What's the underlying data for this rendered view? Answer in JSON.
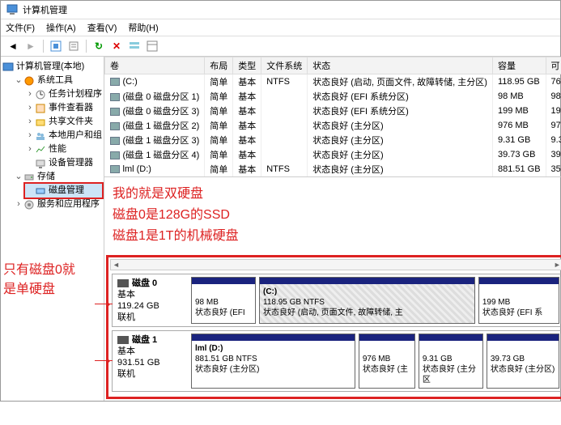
{
  "title": "计算机管理",
  "menu": {
    "file": "文件(F)",
    "action": "操作(A)",
    "view": "查看(V)",
    "help": "帮助(H)"
  },
  "tree": {
    "root": "计算机管理(本地)",
    "sys": "系统工具",
    "sys_items": [
      "任务计划程序",
      "事件查看器",
      "共享文件夹",
      "本地用户和组",
      "性能",
      "设备管理器"
    ],
    "storage": "存储",
    "disk_mgmt": "磁盘管理",
    "services": "服务和应用程序"
  },
  "cols": {
    "vol": "卷",
    "layout": "布局",
    "type": "类型",
    "fs": "文件系统",
    "status": "状态",
    "cap": "容量",
    "free": "可"
  },
  "vols": [
    {
      "n": "(C:)",
      "l": "简单",
      "t": "基本",
      "fs": "NTFS",
      "s": "状态良好 (启动, 页面文件, 故障转储, 主分区)",
      "c": "118.95 GB",
      "f": "76"
    },
    {
      "n": "(磁盘 0 磁盘分区 1)",
      "l": "简单",
      "t": "基本",
      "fs": "",
      "s": "状态良好 (EFI 系统分区)",
      "c": "98 MB",
      "f": "98"
    },
    {
      "n": "(磁盘 0 磁盘分区 3)",
      "l": "简单",
      "t": "基本",
      "fs": "",
      "s": "状态良好 (EFI 系统分区)",
      "c": "199 MB",
      "f": "19"
    },
    {
      "n": "(磁盘 1 磁盘分区 2)",
      "l": "简单",
      "t": "基本",
      "fs": "",
      "s": "状态良好 (主分区)",
      "c": "976 MB",
      "f": "97"
    },
    {
      "n": "(磁盘 1 磁盘分区 3)",
      "l": "简单",
      "t": "基本",
      "fs": "",
      "s": "状态良好 (主分区)",
      "c": "9.31 GB",
      "f": "9.3"
    },
    {
      "n": "(磁盘 1 磁盘分区 4)",
      "l": "简单",
      "t": "基本",
      "fs": "",
      "s": "状态良好 (主分区)",
      "c": "39.73 GB",
      "f": "39"
    },
    {
      "n": "lml (D:)",
      "l": "简单",
      "t": "基本",
      "fs": "NTFS",
      "s": "状态良好 (主分区)",
      "c": "881.51 GB",
      "f": "35"
    }
  ],
  "anno": {
    "l1": "我的就是双硬盘",
    "l2": "磁盘0是128G的SSD",
    "l3": "磁盘1是1T的机械硬盘",
    "left1": "只有磁盘0就",
    "left2": "是单硬盘"
  },
  "disk0": {
    "name": "磁盘 0",
    "type": "基本",
    "size": "119.24 GB",
    "state": "联机",
    "p1": {
      "l1": "98 MB",
      "l2": "状态良好 (EFI"
    },
    "p2": {
      "l0": "(C:)",
      "l1": "118.95 GB NTFS",
      "l2": "状态良好 (启动, 页面文件, 故障转储, 主"
    },
    "p3": {
      "l1": "199 MB",
      "l2": "状态良好 (EFI 系"
    }
  },
  "disk1": {
    "name": "磁盘 1",
    "type": "基本",
    "size": "931.51 GB",
    "state": "联机",
    "p1": {
      "l0": "lml (D:)",
      "l1": "881.51 GB NTFS",
      "l2": "状态良好 (主分区)"
    },
    "p2": {
      "l1": "976 MB",
      "l2": "状态良好 (主"
    },
    "p3": {
      "l1": "9.31 GB",
      "l2": "状态良好 (主分区"
    },
    "p4": {
      "l1": "39.73 GB",
      "l2": "状态良好 (主分区)"
    }
  }
}
